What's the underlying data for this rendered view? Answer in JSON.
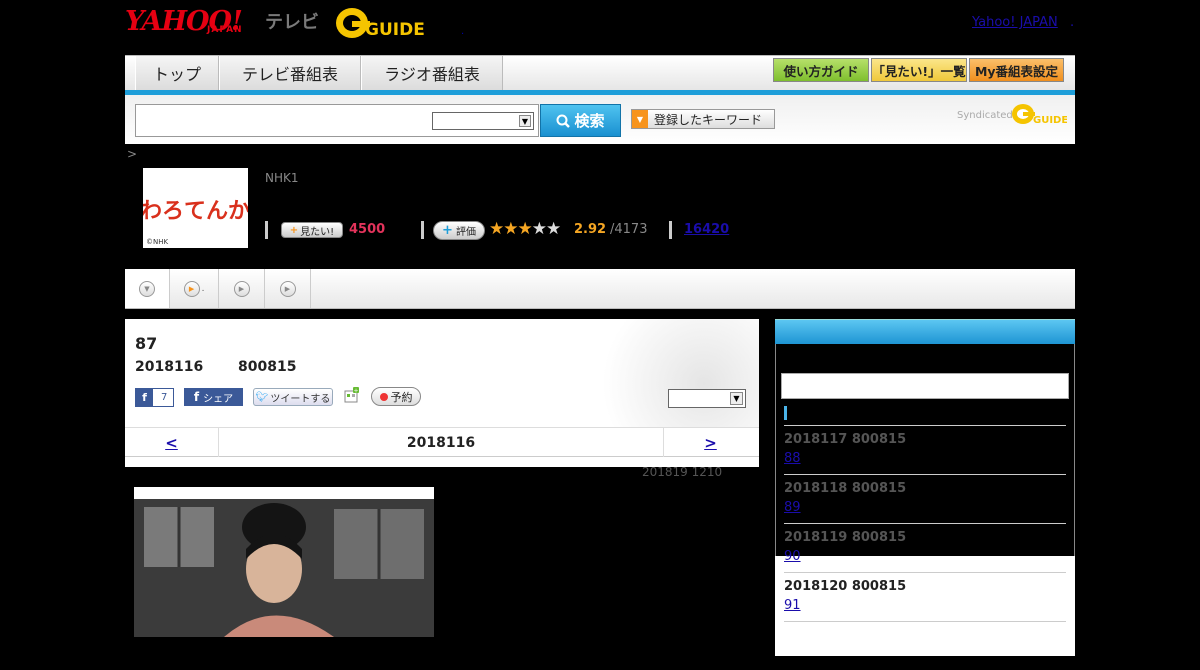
{
  "header": {
    "logo_yahoo": "YAHOO!",
    "logo_japan": "JAPAN",
    "logo_tv": "テレビ",
    "logo_gguide": "G GUIDE",
    "dot": ".",
    "yahoo_japan_link": "Yahoo! JAPAN",
    "tail_dot": "."
  },
  "nav": {
    "tabs": [
      {
        "label": "トップ"
      },
      {
        "label": "テレビ番組表"
      },
      {
        "label": "ラジオ番組表"
      }
    ],
    "buttons": [
      {
        "label": "使い方ガイド"
      },
      {
        "label": "「見たい!」一覧"
      },
      {
        "label": "My番組表設定"
      }
    ]
  },
  "search": {
    "input_value": "",
    "button_label": "検索",
    "keyword_button": "登録したキーワード",
    "syndicated": "Syndicated"
  },
  "breadcrumb_gt": ">",
  "program": {
    "image_caption": "©NHK",
    "image_title": "わろてんか",
    "channel": "NHK1",
    "mitai_label": "見たい!",
    "mitai_count": "4500",
    "hyoka_label": "評価",
    "stars_filled": 2.92,
    "rating": "2.92",
    "rating_count": "/4173",
    "review_count": "16420"
  },
  "episode": {
    "title": "87",
    "date": "2018116",
    "time": "800815",
    "fb_like_count": "7",
    "fb_share": "シェア",
    "tweet": "ツイートする",
    "reserve": "予約",
    "prev": "<",
    "current": "2018116",
    "next": ">",
    "updated": "201819  1210"
  },
  "sidebar": {
    "items": [
      {
        "date": "2018117  800815",
        "ep": "88"
      },
      {
        "date": "2018118  800815",
        "ep": "89"
      },
      {
        "date": "2018119  800815",
        "ep": "90"
      },
      {
        "date": "2018120  800815",
        "ep": "91"
      }
    ]
  },
  "colors": {
    "accent_blue": "#1e9ed9",
    "mitai_pink": "#e3335b",
    "star_orange": "#f5a623",
    "nav_btn_green": "#8cc63f",
    "nav_btn_yellow": "#f5d34d",
    "nav_btn_orange": "#f7941d"
  }
}
